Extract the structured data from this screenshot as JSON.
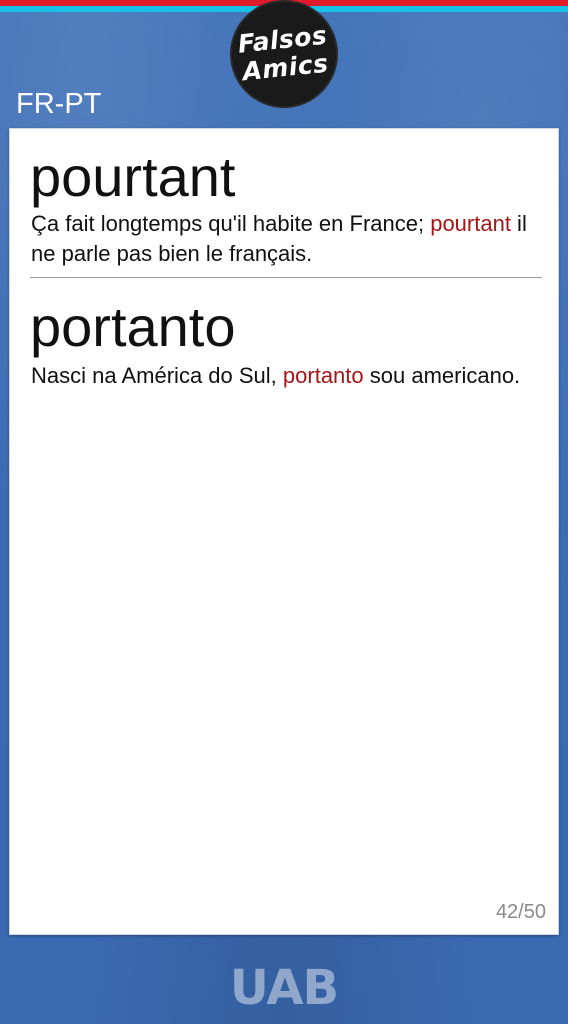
{
  "app": {
    "logo_line1": "Falsos",
    "logo_line2": "Amics",
    "lang_pair": "FR-PT",
    "footer_logo": "UAB"
  },
  "card": {
    "entry1": {
      "word": "pourtant",
      "example_before": "Ça fait longtemps qu'il habite en France; ",
      "example_highlight": "pourtant",
      "example_after": " il ne parle pas bien le français."
    },
    "entry2": {
      "word": "portanto",
      "example_before": "Nasci na América do Sul, ",
      "example_highlight": "portanto",
      "example_after": " sou americano."
    },
    "counter": "42/50"
  },
  "colors": {
    "background": "#3b6db4",
    "highlight": "#a51616",
    "top_red": "#e01b2b",
    "top_cyan": "#17c0e6"
  }
}
